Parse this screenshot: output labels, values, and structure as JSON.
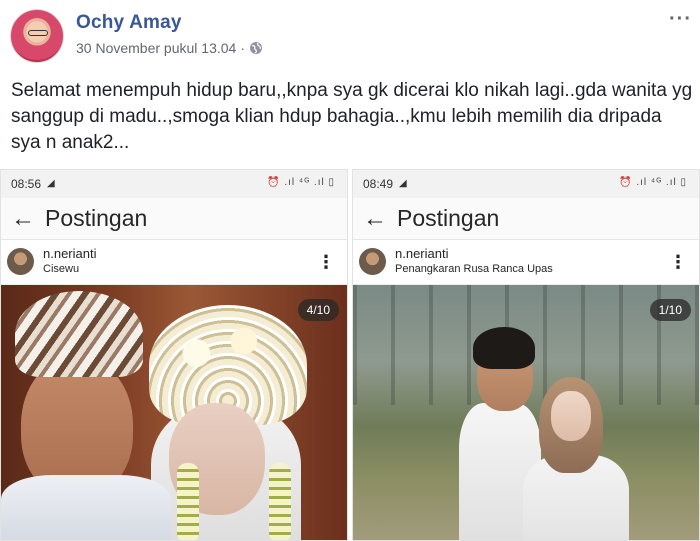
{
  "post": {
    "author": "Ochy Amay",
    "date": "30 November pukul 13.04",
    "separator": "·",
    "more_label": "···",
    "text": "Selamat menempuh hidup baru,,knpa sya gk dicerai klo nikah lagi..gda wanita yg sanggup di madu..,smoga klian hdup bahagia..,kmu lebih memilih dia dripada sya n anak2..."
  },
  "screenshots": [
    {
      "time": "08:56",
      "status_icons": "⏰ .ıl ⁴ᴳ .ıl ▯",
      "title": "Postingan",
      "back_label": "←",
      "username": "n.nerianti",
      "location": "Cisewu",
      "kebab_label": "⋮",
      "counter": "4/10"
    },
    {
      "time": "08:49",
      "status_icons": "⏰ .ıl ⁴ᴳ .ıl ▯",
      "title": "Postingan",
      "back_label": "←",
      "username": "n.nerianti",
      "location": "Penangkaran Rusa Ranca Upas",
      "kebab_label": "⋮",
      "counter": "1/10"
    }
  ],
  "icons": {
    "globe": "globe-icon",
    "more": "more-horizontal-icon",
    "back": "arrow-left-icon",
    "kebab": "kebab-vertical-icon"
  },
  "colors": {
    "author": "#385898",
    "meta": "#616770",
    "text": "#1d2129"
  }
}
